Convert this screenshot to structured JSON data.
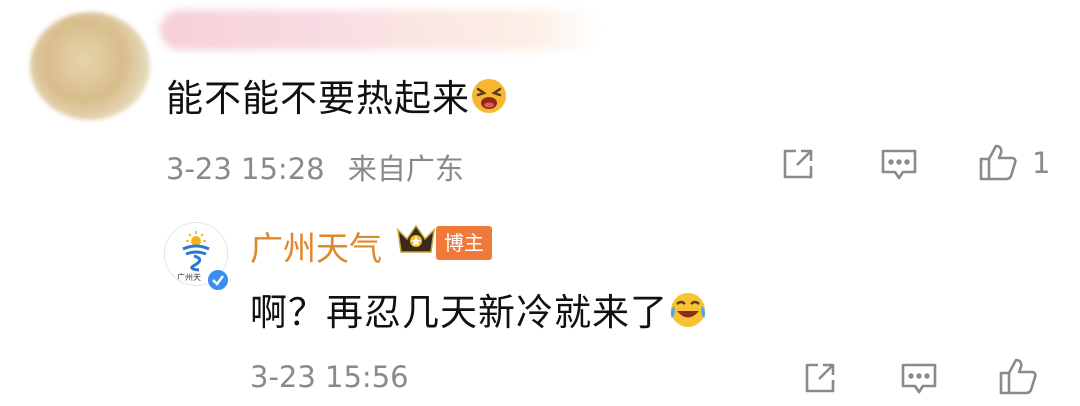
{
  "comment": {
    "text": "能不能不要热起来",
    "emoji": "crying-face-emoji",
    "timestamp": "3-23 15:28",
    "location": "来自广东",
    "like_count": "1"
  },
  "reply": {
    "username": "广州天气",
    "badge": "博主",
    "avatar_text": "广州天",
    "text": "啊？再忍几天新冷就来了",
    "emoji": "laughing-tears-emoji",
    "timestamp": "3-23 15:56"
  },
  "colors": {
    "name_orange": "#e2862a",
    "badge_orange": "#f07a3c",
    "meta_gray": "#8a8a8a",
    "verify_blue": "#3a8ef0"
  },
  "icons": {
    "share": "share-external-icon",
    "comment": "comment-bubble-icon",
    "like": "thumbs-up-icon",
    "crown": "crown-badge-icon"
  }
}
